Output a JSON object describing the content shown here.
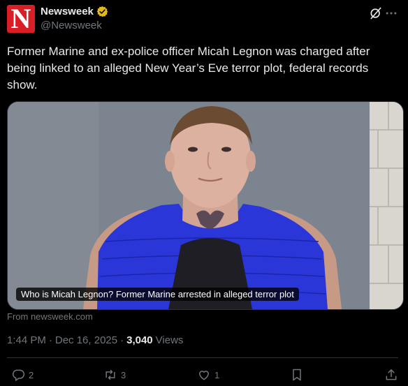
{
  "account": {
    "display_name": "Newsweek",
    "handle": "@Newsweek",
    "logo_letter": "N",
    "logo_color": "#d81f26",
    "verified_color": "#e2b719"
  },
  "tweet": {
    "text": "Former Marine and ex-police officer Micah Legnon was charged after being linked to an alleged New Year’s Eve terror plot, federal records show."
  },
  "media": {
    "caption": "Who is Micah Legnon? Former Marine arrested in alleged terror plot",
    "source": "From newsweek.com"
  },
  "meta": {
    "time": "1:44 PM",
    "separator": "·",
    "date": "Dec 16, 2025",
    "views_count": "3,040",
    "views_label": "Views"
  },
  "actions": {
    "replies": "2",
    "reposts": "3",
    "likes": "1"
  },
  "icons": [
    "verified-badge-icon",
    "grok-icon",
    "reply-icon",
    "repost-icon",
    "like-icon",
    "bookmark-icon",
    "share-icon"
  ]
}
